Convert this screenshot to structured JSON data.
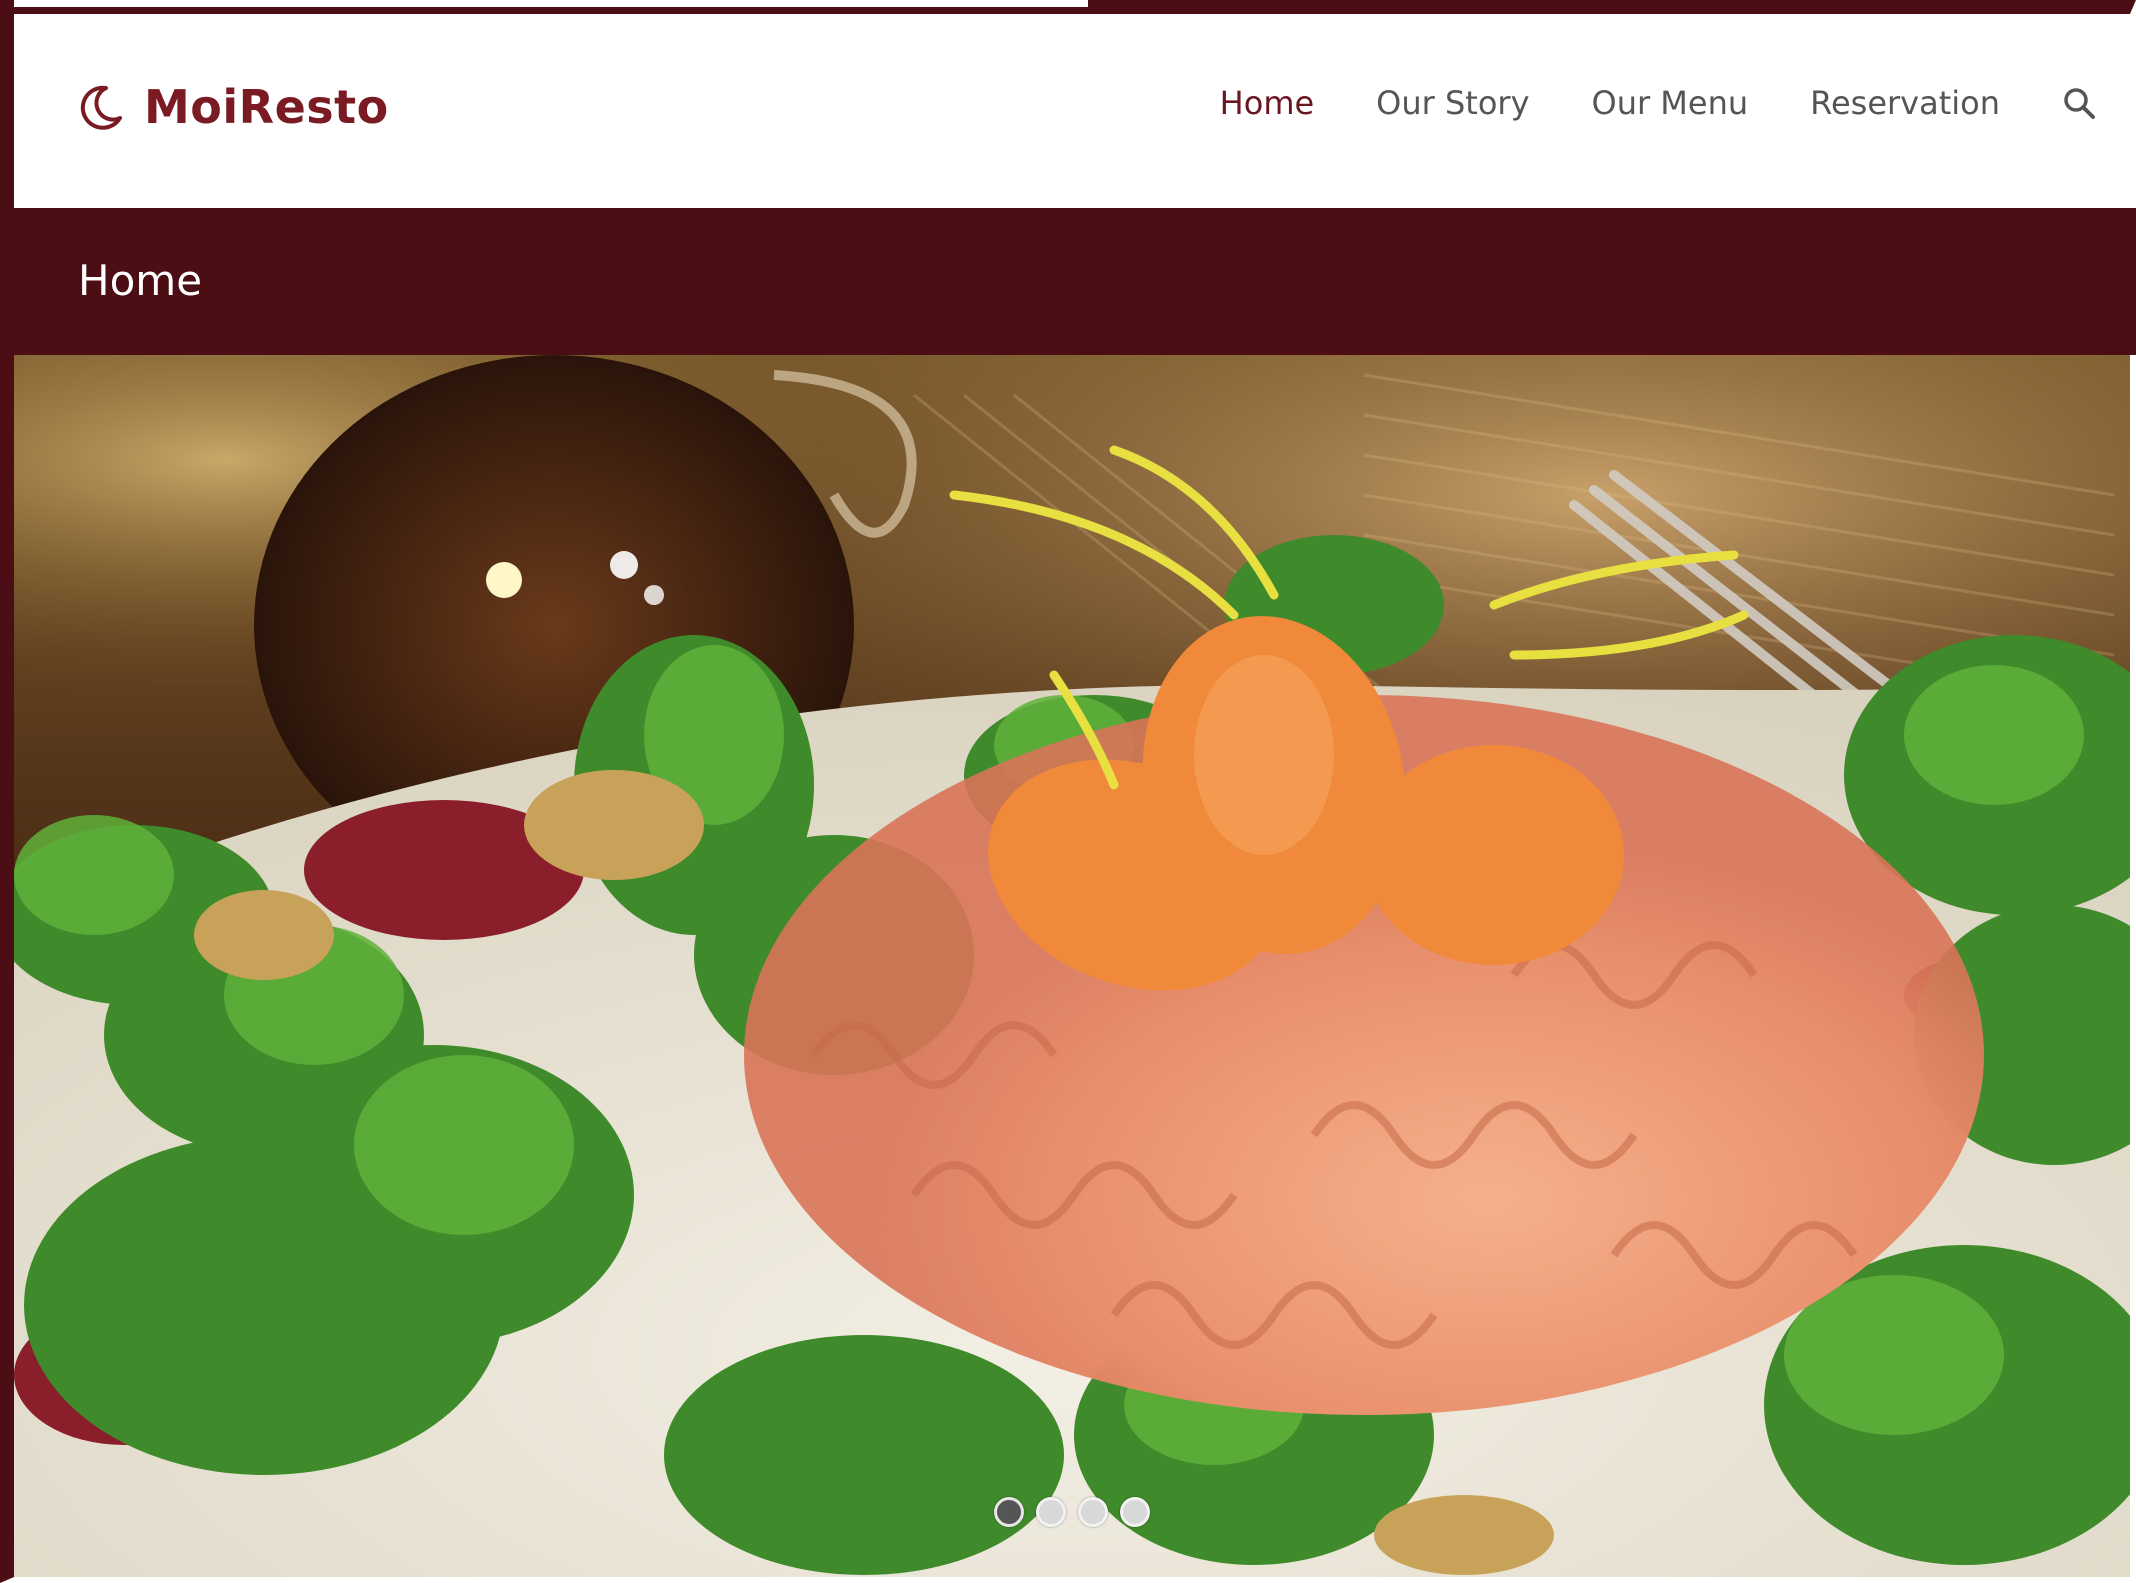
{
  "brand": {
    "name": "MoiResto",
    "icon": "moon-icon",
    "color": "#7a1a22"
  },
  "nav": {
    "items": [
      {
        "label": "Home",
        "active": true
      },
      {
        "label": "Our Story",
        "active": false
      },
      {
        "label": "Our Menu",
        "active": false
      },
      {
        "label": "Reservation",
        "active": false
      }
    ],
    "search_icon": "search-icon"
  },
  "page": {
    "title": "Home",
    "title_bar_color": "#4a0e14"
  },
  "slider": {
    "image": "pasta-salad-photo",
    "slide_count": 4,
    "active_slide": 1
  }
}
